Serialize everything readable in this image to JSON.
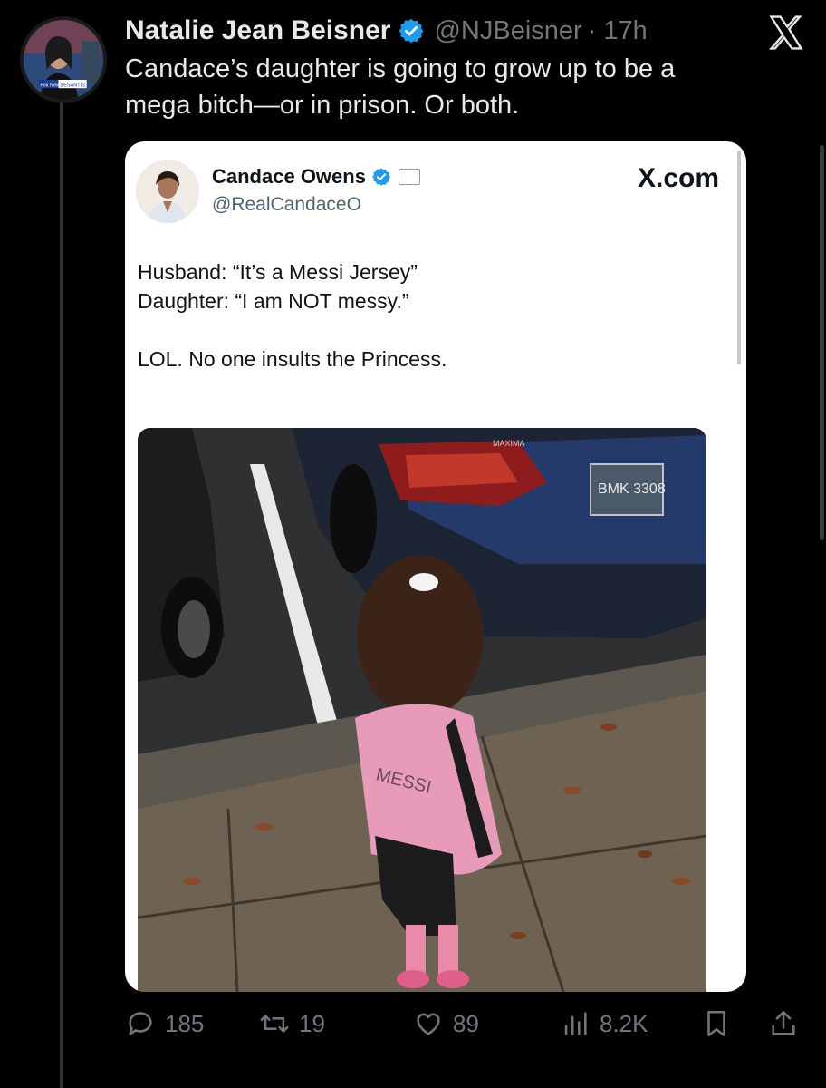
{
  "colors": {
    "background": "#000000",
    "text": "#e7e9ea",
    "muted": "#71767b",
    "verified": "#1d9bf0",
    "card_background": "#ffffff"
  },
  "tweet": {
    "author": {
      "display_name": "Natalie Jean Beisner",
      "handle": "@NJBeisner",
      "time": "· 17h",
      "avatar_icon": "profile-photo",
      "verified_icon": "verified-badge-icon",
      "avatar_overlay": {
        "network": "Fox News",
        "text": "DESANTIS"
      }
    },
    "text_lines": [
      "Candace’s daughter is going to grow up to be a",
      "mega bitch—or in prison. Or both."
    ],
    "app_logo_icon": "x-logo-icon",
    "quoted": {
      "display_name": "Candace Owens",
      "handle": "@RealCandaceO",
      "site": "X.com",
      "text_lines": [
        "Husband: “It’s a Messi Jersey”",
        "Daughter:  “I am NOT messy.”",
        "",
        "LOL. No one insults the Princess."
      ],
      "photo": {
        "jersey_name": "MESSI",
        "license_plate": "BMK 3308",
        "car_badge": "MAXIMA"
      }
    },
    "actions": {
      "replies": "185",
      "reposts": "19",
      "likes": "89",
      "views": "8.2K"
    }
  }
}
